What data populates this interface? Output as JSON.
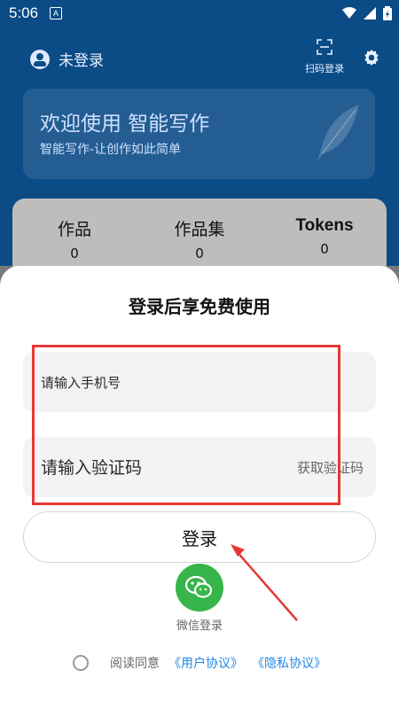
{
  "status": {
    "time": "5:06",
    "notification_badge": "A"
  },
  "header": {
    "user_label": "未登录",
    "scan_label": "扫码登录"
  },
  "banner": {
    "title": "欢迎使用 智能写作",
    "subtitle": "智能写作-让创作如此简单"
  },
  "stats": [
    {
      "label": "作品",
      "value": "0"
    },
    {
      "label": "作品集",
      "value": "0"
    },
    {
      "label": "Tokens",
      "value": "0"
    }
  ],
  "login": {
    "title": "登录后享免费使用",
    "phone_placeholder": "请输入手机号",
    "phone_value": "",
    "code_placeholder": "请输入验证码",
    "code_value": "",
    "get_code_label": "获取验证码",
    "login_button": "登录",
    "wechat_label": "微信登录",
    "agree_prefix": "阅读同意",
    "user_agreement": "《用户协议》",
    "privacy_agreement": "《隐私协议》"
  },
  "colors": {
    "header_bg": "#0b4b86",
    "accent_link": "#1e88e5",
    "wechat_green": "#37b54a",
    "annotation_red": "#e53935"
  },
  "icons": {
    "user": "account-circle-icon",
    "scan": "scan-icon",
    "settings": "gear-icon",
    "wechat": "wechat-icon",
    "radio": "radio-unchecked-icon"
  }
}
